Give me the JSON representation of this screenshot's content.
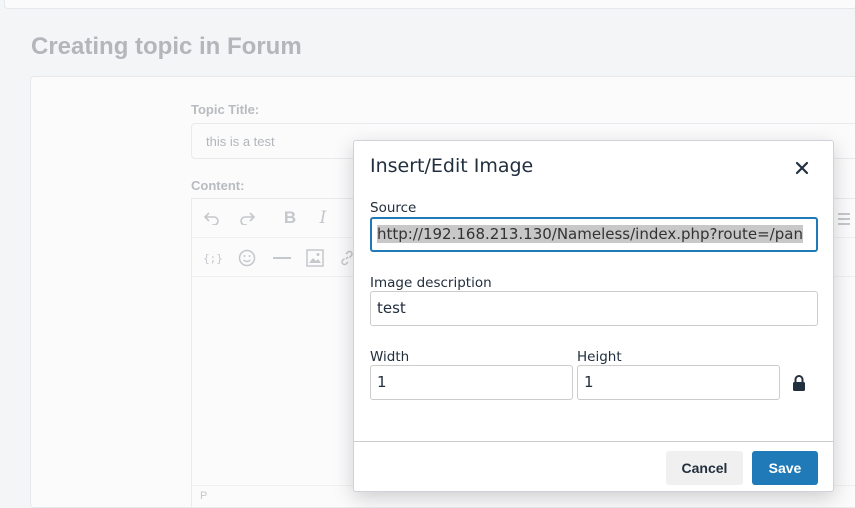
{
  "page": {
    "title": "Creating topic in Forum",
    "topic_title_label": "Topic Title:",
    "topic_title_value": "this is a test",
    "content_label": "Content:",
    "statusbar_text": "P"
  },
  "dialog": {
    "title": "Insert/Edit Image",
    "source_label": "Source",
    "source_value": "http://192.168.213.130/Nameless/index.php?route=/pan",
    "description_label": "Image description",
    "description_value": "test",
    "width_label": "Width",
    "width_value": "1",
    "height_label": "Height",
    "height_value": "1",
    "cancel_label": "Cancel",
    "save_label": "Save"
  },
  "icons": {
    "close": "close-icon",
    "lock": "lock-icon",
    "undo": "undo-icon",
    "redo": "redo-icon",
    "bold": "bold-icon",
    "italic": "italic-icon",
    "code": "code-icon",
    "emoji": "emoji-icon",
    "hr": "horizontal-rule-icon",
    "image": "image-icon",
    "link": "link-icon",
    "align": "align-icon"
  },
  "colors": {
    "accent": "#207ab7",
    "dialog_text": "#222f3e",
    "muted_text": "#b3b6ba"
  }
}
